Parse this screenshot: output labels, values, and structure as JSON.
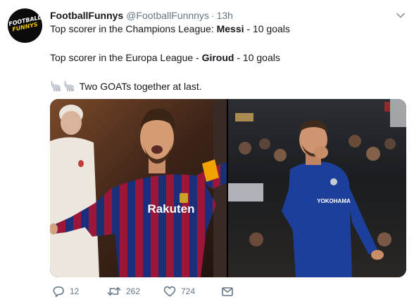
{
  "tweet": {
    "avatar_text_line1": "FOOTBALL",
    "avatar_text_line2": "FUNNYS",
    "display_name": "FootballFunnys",
    "handle": "@FootballFunnnys",
    "separator": "·",
    "time": "13h",
    "line1_prefix": "Top scorer in the Champions League: ",
    "line1_bold": "Messi",
    "line1_suffix": " - 10 goals",
    "line2_prefix": "Top scorer in the Europa League - ",
    "line2_bold": "Giroud",
    "line2_suffix": " - 10 goals",
    "line3_text": " Two GOATs together at last.",
    "emoji": [
      "goat-emoji",
      "goat-emoji"
    ],
    "media": {
      "left_photo_text": "Rakuten",
      "right_photo_text": "YOKOHAMA"
    },
    "actions": {
      "reply_count": "12",
      "retweet_count": "262",
      "like_count": "724",
      "icons": [
        "reply-icon",
        "retweet-icon",
        "heart-icon",
        "envelope-icon"
      ]
    }
  },
  "colors": {
    "text": "#14171a",
    "muted": "#657786",
    "barca_blue": "#1b2f78",
    "barca_red": "#9b1637",
    "chelsea_blue": "#1d3f9c",
    "armband": "#f0a300"
  }
}
